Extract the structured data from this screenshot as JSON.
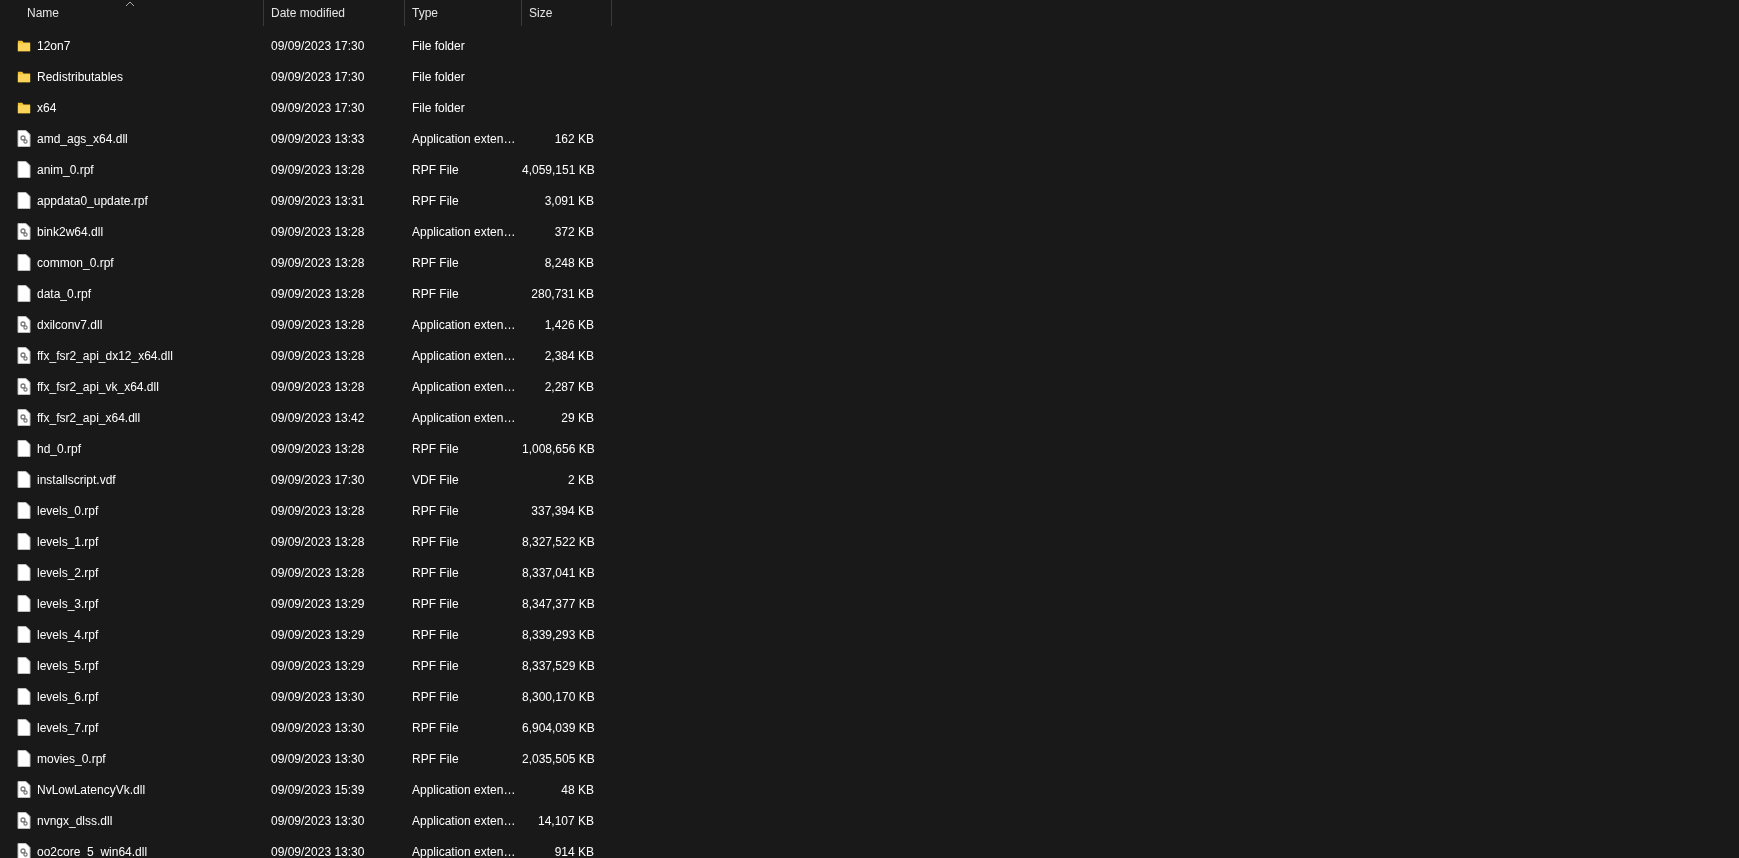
{
  "columns": [
    {
      "label": "Name",
      "sorted_ascending": true
    },
    {
      "label": "Date modified"
    },
    {
      "label": "Type"
    },
    {
      "label": "Size"
    }
  ],
  "rows": [
    {
      "kind": "folder",
      "name": "12on7",
      "date": "09/09/2023 17:30",
      "type": "File folder"
    },
    {
      "kind": "folder",
      "name": "Redistributables",
      "date": "09/09/2023 17:30",
      "type": "File folder"
    },
    {
      "kind": "folder",
      "name": "x64",
      "date": "09/09/2023 17:30",
      "type": "File folder"
    },
    {
      "kind": "dll",
      "name": "amd_ags_x64.dll",
      "date": "09/09/2023 13:33",
      "type": "Application exten…",
      "size": "162 KB"
    },
    {
      "kind": "file",
      "name": "anim_0.rpf",
      "date": "09/09/2023 13:28",
      "type": "RPF File",
      "size": "4,059,151 KB"
    },
    {
      "kind": "file",
      "name": "appdata0_update.rpf",
      "date": "09/09/2023 13:31",
      "type": "RPF File",
      "size": "3,091 KB"
    },
    {
      "kind": "dll",
      "name": "bink2w64.dll",
      "date": "09/09/2023 13:28",
      "type": "Application exten…",
      "size": "372 KB"
    },
    {
      "kind": "file",
      "name": "common_0.rpf",
      "date": "09/09/2023 13:28",
      "type": "RPF File",
      "size": "8,248 KB"
    },
    {
      "kind": "file",
      "name": "data_0.rpf",
      "date": "09/09/2023 13:28",
      "type": "RPF File",
      "size": "280,731 KB"
    },
    {
      "kind": "dll",
      "name": "dxilconv7.dll",
      "date": "09/09/2023 13:28",
      "type": "Application exten…",
      "size": "1,426 KB"
    },
    {
      "kind": "dll",
      "name": "ffx_fsr2_api_dx12_x64.dll",
      "date": "09/09/2023 13:28",
      "type": "Application exten…",
      "size": "2,384 KB"
    },
    {
      "kind": "dll",
      "name": "ffx_fsr2_api_vk_x64.dll",
      "date": "09/09/2023 13:28",
      "type": "Application exten…",
      "size": "2,287 KB"
    },
    {
      "kind": "dll",
      "name": "ffx_fsr2_api_x64.dll",
      "date": "09/09/2023 13:42",
      "type": "Application exten…",
      "size": "29 KB"
    },
    {
      "kind": "file",
      "name": "hd_0.rpf",
      "date": "09/09/2023 13:28",
      "type": "RPF File",
      "size": "1,008,656 KB"
    },
    {
      "kind": "file",
      "name": "installscript.vdf",
      "date": "09/09/2023 17:30",
      "type": "VDF File",
      "size": "2 KB"
    },
    {
      "kind": "file",
      "name": "levels_0.rpf",
      "date": "09/09/2023 13:28",
      "type": "RPF File",
      "size": "337,394 KB"
    },
    {
      "kind": "file",
      "name": "levels_1.rpf",
      "date": "09/09/2023 13:28",
      "type": "RPF File",
      "size": "8,327,522 KB"
    },
    {
      "kind": "file",
      "name": "levels_2.rpf",
      "date": "09/09/2023 13:28",
      "type": "RPF File",
      "size": "8,337,041 KB"
    },
    {
      "kind": "file",
      "name": "levels_3.rpf",
      "date": "09/09/2023 13:29",
      "type": "RPF File",
      "size": "8,347,377 KB"
    },
    {
      "kind": "file",
      "name": "levels_4.rpf",
      "date": "09/09/2023 13:29",
      "type": "RPF File",
      "size": "8,339,293 KB"
    },
    {
      "kind": "file",
      "name": "levels_5.rpf",
      "date": "09/09/2023 13:29",
      "type": "RPF File",
      "size": "8,337,529 KB"
    },
    {
      "kind": "file",
      "name": "levels_6.rpf",
      "date": "09/09/2023 13:30",
      "type": "RPF File",
      "size": "8,300,170 KB"
    },
    {
      "kind": "file",
      "name": "levels_7.rpf",
      "date": "09/09/2023 13:30",
      "type": "RPF File",
      "size": "6,904,039 KB"
    },
    {
      "kind": "file",
      "name": "movies_0.rpf",
      "date": "09/09/2023 13:30",
      "type": "RPF File",
      "size": "2,035,505 KB"
    },
    {
      "kind": "dll",
      "name": "NvLowLatencyVk.dll",
      "date": "09/09/2023 15:39",
      "type": "Application exten…",
      "size": "48 KB"
    },
    {
      "kind": "dll",
      "name": "nvngx_dlss.dll",
      "date": "09/09/2023 13:30",
      "type": "Application exten…",
      "size": "14,107 KB"
    },
    {
      "kind": "dll",
      "name": "oo2core_5_win64.dll",
      "date": "09/09/2023 13:30",
      "type": "Application exten…",
      "size": "914 KB"
    }
  ]
}
